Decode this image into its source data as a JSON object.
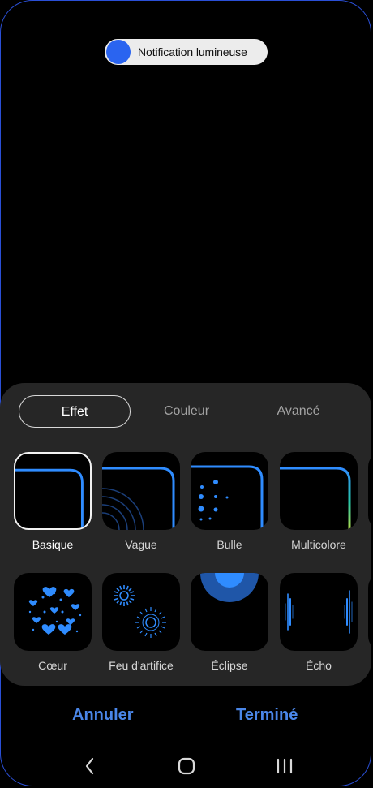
{
  "toggle": {
    "label": "Notification lumineuse",
    "enabled": true,
    "color": "#2a64f0"
  },
  "tabs": [
    {
      "label": "Effet",
      "active": true
    },
    {
      "label": "Couleur",
      "active": false
    },
    {
      "label": "Avancé",
      "active": false
    }
  ],
  "effects": [
    {
      "label": "Basique",
      "icon": "basic-edge-icon",
      "selected": true
    },
    {
      "label": "Vague",
      "icon": "wave-icon",
      "selected": false
    },
    {
      "label": "Bulle",
      "icon": "bubble-icon",
      "selected": false
    },
    {
      "label": "Multicolore",
      "icon": "multicolor-icon",
      "selected": false
    },
    {
      "label": "Cœur",
      "icon": "heart-icon",
      "selected": false
    },
    {
      "label": "Feu d'artifice",
      "icon": "firework-icon",
      "selected": false
    },
    {
      "label": "Éclipse",
      "icon": "eclipse-icon",
      "selected": false
    },
    {
      "label": "Écho",
      "icon": "echo-icon",
      "selected": false
    }
  ],
  "actions": {
    "cancel": "Annuler",
    "done": "Terminé"
  },
  "colors": {
    "accent": "#4a86e8",
    "edge": "#2f8cff",
    "panel": "#262626"
  },
  "nav": [
    "back-icon",
    "home-icon",
    "recents-icon"
  ]
}
